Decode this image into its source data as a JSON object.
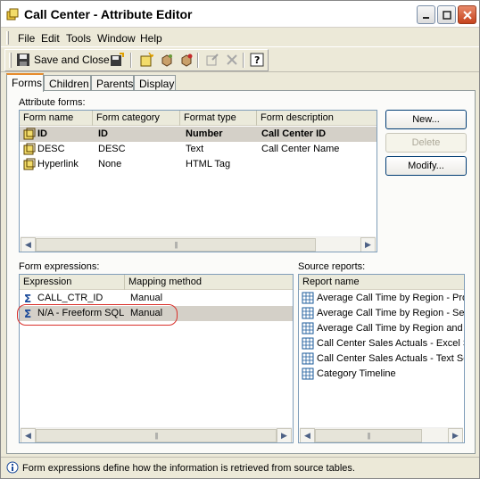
{
  "window": {
    "title": "Call Center - Attribute Editor"
  },
  "menu": [
    "File",
    "Edit",
    "Tools",
    "Window",
    "Help"
  ],
  "toolbar": {
    "save_close_label": "Save and Close"
  },
  "tabs": [
    "Forms",
    "Children",
    "Parents",
    "Display"
  ],
  "attribute_forms": {
    "label": "Attribute forms:",
    "columns": [
      "Form name",
      "Form category",
      "Format type",
      "Form description"
    ],
    "rows": [
      {
        "name": "ID",
        "category": "ID",
        "format": "Number",
        "description": "Call Center ID"
      },
      {
        "name": "DESC",
        "category": "DESC",
        "format": "Text",
        "description": "Call Center Name"
      },
      {
        "name": "Hyperlink",
        "category": "None",
        "format": "HTML Tag",
        "description": ""
      }
    ]
  },
  "buttons": {
    "new": "New...",
    "delete": "Delete",
    "modify": "Modify..."
  },
  "form_expressions": {
    "label": "Form expressions:",
    "columns": [
      "Expression",
      "Mapping method"
    ],
    "rows": [
      {
        "expression": "CALL_CTR_ID",
        "mapping": "Manual"
      },
      {
        "expression": "N/A - Freeform SQL",
        "mapping": "Manual"
      }
    ]
  },
  "source_reports": {
    "label": "Source reports:",
    "columns": [
      "Report name"
    ],
    "rows": [
      "Average Call Time by Region - Pro",
      "Average Call Time by Region - Sec",
      "Average Call Time by Region and C",
      "Call Center Sales Actuals - Excel Sa",
      "Call Center Sales Actuals - Text Sc",
      "Category Timeline"
    ]
  },
  "status": {
    "text": "Form expressions define how the information is retrieved from source tables."
  }
}
